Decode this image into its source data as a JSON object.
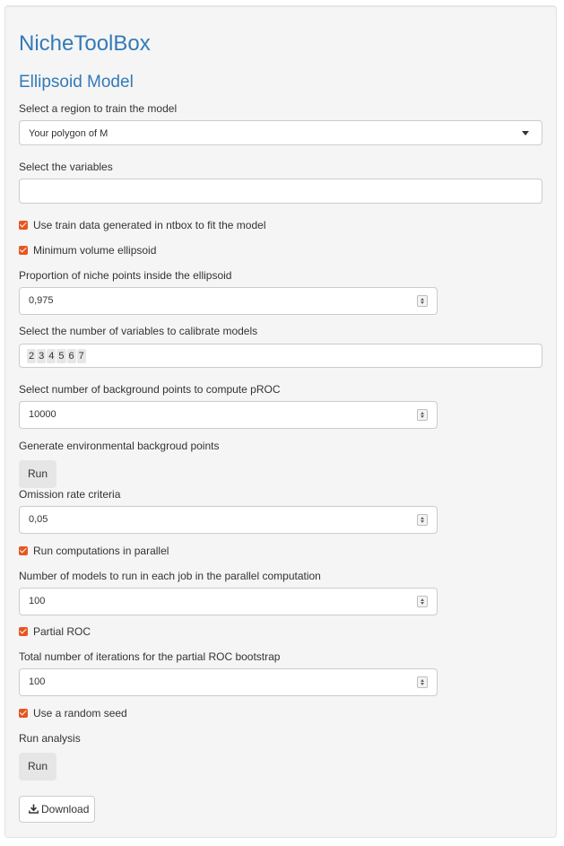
{
  "app_title": "NicheToolBox",
  "section_title": "Ellipsoid Model",
  "region": {
    "label": "Select a region to train the model",
    "selected": "Your polygon of M"
  },
  "variables": {
    "label": "Select the variables",
    "value": ""
  },
  "use_train_data": {
    "label": "Use train data generated in ntbox to fit the model",
    "checked": true
  },
  "min_volume": {
    "label": "Minimum volume ellipsoid",
    "checked": true
  },
  "proportion": {
    "label": "Proportion of niche points inside the ellipsoid",
    "value": "0,975"
  },
  "num_vars": {
    "label": "Select the number of variables to calibrate models",
    "chips": [
      "2",
      "3",
      "4",
      "5",
      "6",
      "7"
    ]
  },
  "background_points": {
    "label": "Select number of background points to compute pROC",
    "value": "10000"
  },
  "generate_env": {
    "label": "Generate environmental backgroud points",
    "button": "Run"
  },
  "omission": {
    "label": "Omission rate criteria",
    "value": "0,05"
  },
  "parallel": {
    "label": "Run computations in parallel",
    "checked": true
  },
  "models_per_job": {
    "label": "Number of models to run in each job in the parallel computation",
    "value": "100"
  },
  "partial_roc": {
    "label": "Partial ROC",
    "checked": true
  },
  "iterations": {
    "label": "Total number of iterations for the partial ROC bootstrap",
    "value": "100"
  },
  "random_seed": {
    "label": "Use a random seed",
    "checked": true
  },
  "run_analysis": {
    "label": "Run analysis",
    "button": "Run"
  },
  "download": {
    "label": "Download",
    "icon": "download-icon"
  },
  "colors": {
    "accent": "#337ab7",
    "checkbox": "#e8561f",
    "panel": "#f5f5f5"
  }
}
